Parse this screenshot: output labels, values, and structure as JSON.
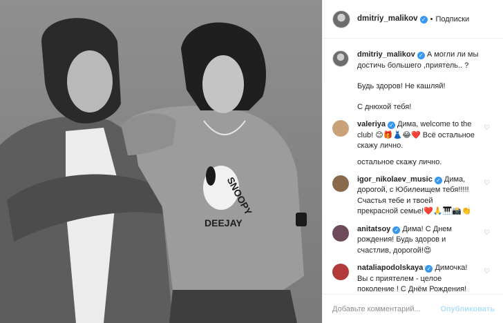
{
  "header": {
    "username": "dmitriy_malikov",
    "separator": "•",
    "follow_label": "Подписки"
  },
  "caption": {
    "username": "dmitriy_malikov",
    "text": "А могли ли мы достичь большего ,приятель.. ?",
    "line2": "Будь здоров! Не кашляй!",
    "line3": "С днюхой тебя!"
  },
  "comments": [
    {
      "username": "valeriya",
      "text": "Дима, welcome to the club! 😊🎁👗😂❤️ Всё остальное скажу лично.",
      "avatar_color": "#c9a27a"
    },
    {
      "username": "igor_nikolaev_music",
      "text": "Дима, дорогой, с Юбилеищем тебя!!!!! Счастья тебе и твоей прекрасной семье!❤️🙏🎹📸👏",
      "avatar_color": "#8a6a4a"
    },
    {
      "username": "anitatsoy",
      "text": "Дима! С Днем рождения! Будь здоров и счастлив, дорогой!😍",
      "avatar_color": "#6e4b5a"
    },
    {
      "username": "nataliapodolskaya",
      "text": "Димочка! Вы с приятелем - целое поколение ! С Днём Рождения! Будь здоров 🏉",
      "avatar_color": "#b23a3a"
    }
  ],
  "stray_text": "остальное скажу лично.",
  "composer": {
    "placeholder": "Добавьте комментарий...",
    "publish_label": "Опубликовать"
  },
  "photo": {
    "sweatshirt_text_top": "SNOOPY",
    "sweatshirt_text_bottom": "DEEJAY"
  },
  "colors": {
    "verified": "#3897f0",
    "publish_disabled": "#b2dffc",
    "muted": "#8e8e8e"
  }
}
